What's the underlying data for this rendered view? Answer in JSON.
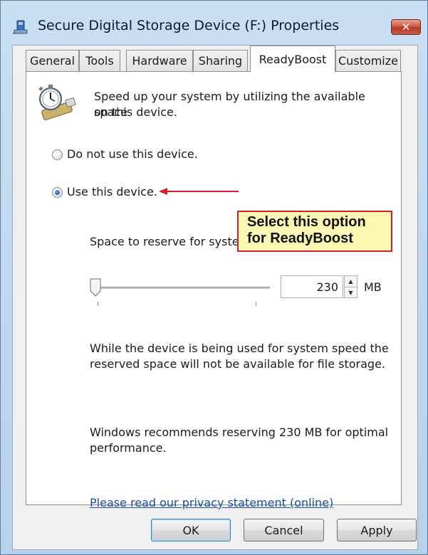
{
  "window": {
    "title": "Secure Digital Storage Device (F:) Properties",
    "close_symbol": "✕"
  },
  "tabs": [
    {
      "label": "General"
    },
    {
      "label": "Tools"
    },
    {
      "label": "Hardware"
    },
    {
      "label": "Sharing"
    },
    {
      "label": "ReadyBoost",
      "selected": true
    },
    {
      "label": "Customize"
    }
  ],
  "readyboost": {
    "intro_line1": "Speed up your system by utilizing the available space",
    "intro_line2": "on this device.",
    "option_do_not_use": "Do not use this device.",
    "option_use": "Use this device.",
    "selected_option": "Use this device.",
    "reserve_label": "Space to reserve for system speed:",
    "reserve_value": "230",
    "reserve_unit": "MB",
    "slider_position_fraction": 0,
    "note_line1": "While the device is being used for system speed the",
    "note_line2": "reserved space will not be available for file storage.",
    "recommend_line1": "Windows recommends reserving 230 MB for optimal",
    "recommend_line2": "performance.",
    "privacy_link": "Please read our privacy statement (online)"
  },
  "callout": {
    "line1": "Select this option",
    "line2": "for ReadyBoost",
    "border_color": "#d0202a",
    "background_color": "#fdf7b4"
  },
  "buttons": {
    "ok": "OK",
    "cancel": "Cancel",
    "apply": "Apply"
  },
  "icons": {
    "window": "usb-drive-icon",
    "readyboost": "stopwatch-usb-icon",
    "close": "close-icon"
  }
}
